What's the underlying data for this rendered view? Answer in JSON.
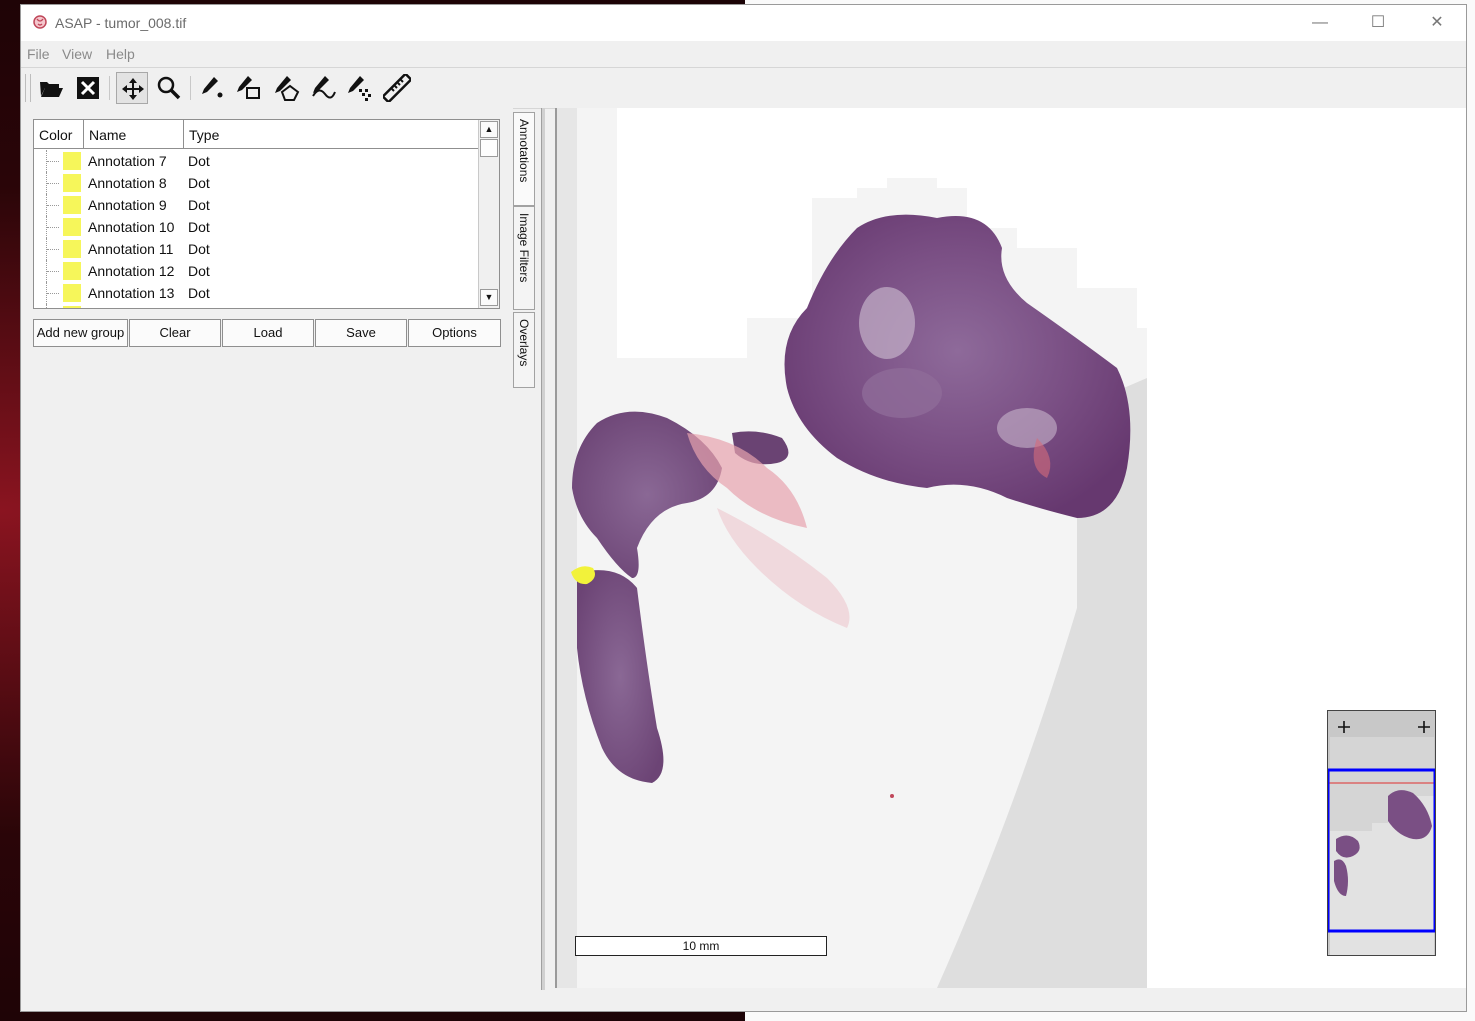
{
  "window": {
    "title": "ASAP - tumor_008.tif",
    "controls": {
      "minimize": "—",
      "maximize": "☐",
      "close": "✕"
    }
  },
  "menu": [
    "File",
    "View",
    "Help"
  ],
  "toolbar": {
    "tools": [
      "open-file",
      "close-file",
      "pan",
      "zoom",
      "dot-annotation",
      "rectangle-annotation",
      "polygon-annotation",
      "spline-annotation",
      "pointset-annotation",
      "measurement-ruler"
    ],
    "active_tool": "pan"
  },
  "annotations": {
    "columns": [
      "Color",
      "Name",
      "Type"
    ],
    "rows": [
      {
        "name": "Annotation 7",
        "type": "Dot",
        "color": "#f6f65a"
      },
      {
        "name": "Annotation 8",
        "type": "Dot",
        "color": "#f6f65a"
      },
      {
        "name": "Annotation 9",
        "type": "Dot",
        "color": "#f6f65a"
      },
      {
        "name": "Annotation 10",
        "type": "Dot",
        "color": "#f6f65a"
      },
      {
        "name": "Annotation 11",
        "type": "Dot",
        "color": "#f6f65a"
      },
      {
        "name": "Annotation 12",
        "type": "Dot",
        "color": "#f6f65a"
      },
      {
        "name": "Annotation 13",
        "type": "Dot",
        "color": "#f6f65a"
      }
    ],
    "buttons": {
      "add_group": "Add new group",
      "clear": "Clear",
      "load": "Load",
      "save": "Save",
      "options": "Options"
    }
  },
  "side_tabs": [
    "Annotations",
    "Image Filters",
    "Overlays"
  ],
  "viewer": {
    "scale_label": "10 mm",
    "annotation_color": "#f2f23a"
  },
  "minimap": {
    "viewport_color": "#0000ff"
  }
}
